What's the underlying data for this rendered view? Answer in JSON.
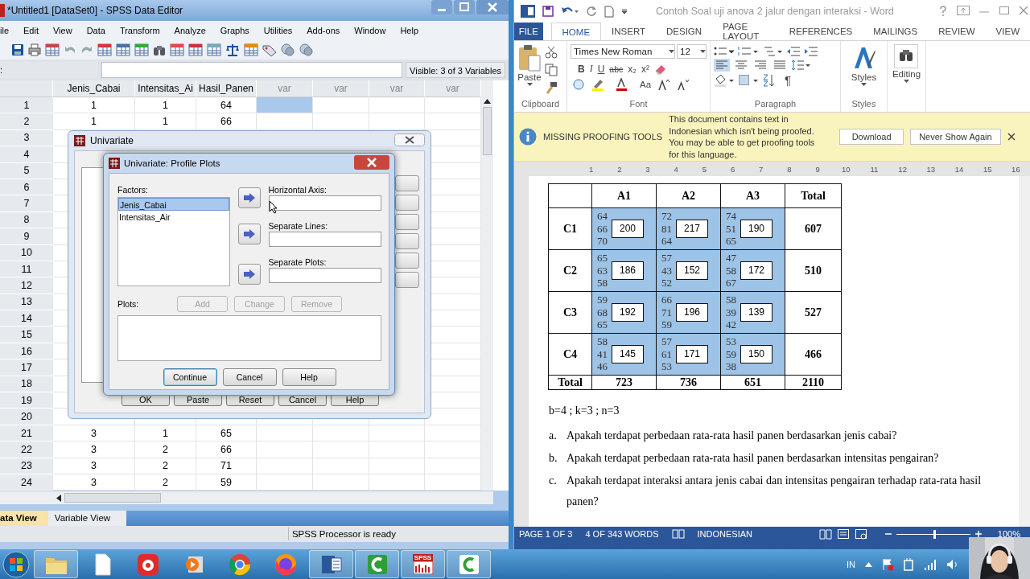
{
  "spss": {
    "title": "*Untitled1 [DataSet0] - SPSS Data Editor",
    "menu": [
      "ile",
      "Edit",
      "View",
      "Data",
      "Transform",
      "Analyze",
      "Graphs",
      "Utilities",
      "Add-ons",
      "Window",
      "Help"
    ],
    "cell_ref": ":",
    "visible_info": "Visible: 3 of 3 Variables",
    "columns": [
      "Jenis_Cabai",
      "Intensitas_Ai",
      "Hasil_Panen",
      "var",
      "var",
      "var",
      "var"
    ],
    "rows": [
      {
        "number": "1",
        "cells": [
          "1",
          "1",
          "64"
        ],
        "var_cell_selected": true
      },
      {
        "number": "2",
        "cells": [
          "1",
          "1",
          "66"
        ],
        "var_cell_selected": false
      },
      {
        "number": "3"
      },
      {
        "number": "4"
      },
      {
        "number": "5"
      },
      {
        "number": "6"
      },
      {
        "number": "7"
      },
      {
        "number": "8"
      },
      {
        "number": "9"
      },
      {
        "number": "10"
      },
      {
        "number": "11"
      },
      {
        "number": "12"
      },
      {
        "number": "13"
      },
      {
        "number": "14"
      },
      {
        "number": "15"
      },
      {
        "number": "16"
      },
      {
        "number": "17"
      },
      {
        "number": "18"
      },
      {
        "number": "19"
      },
      {
        "number": "20"
      },
      {
        "number": "21",
        "cells": [
          "3",
          "1",
          "65"
        ],
        "var_cell_selected": false
      },
      {
        "number": "22",
        "cells": [
          "3",
          "2",
          "66"
        ],
        "var_cell_selected": false
      },
      {
        "number": "23",
        "cells": [
          "3",
          "2",
          "71"
        ],
        "var_cell_selected": false
      },
      {
        "number": "24",
        "cells": [
          "3",
          "2",
          "59"
        ],
        "var_cell_selected": false
      }
    ],
    "tabs": [
      {
        "label": "ata View",
        "selected": true
      },
      {
        "label": "Variable View",
        "selected": false
      }
    ],
    "status": "SPSS  Processor is ready"
  },
  "univariate": {
    "title": "Univariate",
    "buttons": [
      "OK",
      "Paste",
      "Reset",
      "Cancel",
      "Help"
    ]
  },
  "profile_plots": {
    "title": "Univariate: Profile Plots",
    "factors_label": "Factors:",
    "factors": [
      {
        "label": "Jenis_Cabai",
        "selected": true
      },
      {
        "label": "Intensitas_Air",
        "selected": false
      }
    ],
    "targets": [
      "Horizontal Axis:",
      "Separate Lines:",
      "Separate Plots:"
    ],
    "plots_label": "Plots:",
    "plot_buttons": [
      {
        "label": "Add",
        "disabled": true
      },
      {
        "label": "Change",
        "disabled": true
      },
      {
        "label": "Remove",
        "disabled": true
      }
    ],
    "buttons": [
      "Continue",
      "Cancel",
      "Help"
    ]
  },
  "word": {
    "title": "Contoh Soal uji anova 2 jalur dengan interaksi - Word",
    "tabs": [
      {
        "label": "FILE",
        "kind": "file",
        "selected": false
      },
      {
        "label": "HOME",
        "kind": "tab",
        "selected": true
      },
      {
        "label": "INSERT",
        "kind": "tab",
        "selected": false
      },
      {
        "label": "DESIGN",
        "kind": "tab",
        "selected": false
      },
      {
        "label": "PAGE LAYOUT",
        "kind": "tab",
        "selected": false
      },
      {
        "label": "REFERENCES",
        "kind": "tab",
        "selected": false
      },
      {
        "label": "MAILINGS",
        "kind": "tab",
        "selected": false
      },
      {
        "label": "REVIEW",
        "kind": "tab",
        "selected": false
      },
      {
        "label": "VIEW",
        "kind": "tab",
        "selected": false
      }
    ],
    "paste": "Paste",
    "font_name": "Times New Roman",
    "font_size": "12",
    "format_buttons": [
      "B",
      "I",
      "U",
      "abc",
      "x₂",
      "x²"
    ],
    "case_button": "Aa",
    "pilcrow": "¶",
    "alignments": [
      {
        "selected": true
      },
      {
        "selected": false
      },
      {
        "selected": false
      },
      {
        "selected": false
      }
    ],
    "styles": "Styles",
    "editing": "Editing",
    "groups": [
      "Clipboard",
      "Font",
      "Paragraph",
      "Styles"
    ],
    "message": {
      "title": "MISSING PROOFING TOOLS",
      "text": "This document contains text in Indonesian which isn't being proofed. You may be able to get proofing tools for this language.",
      "buttons": [
        "Download",
        "Never Show Again"
      ]
    },
    "ruler": [
      "1",
      "2",
      "3",
      "4",
      "5",
      "6",
      "7",
      "8",
      "9",
      "10",
      "11",
      "12",
      "13",
      "14",
      "15",
      "16"
    ],
    "table": {
      "columns": [
        "A1",
        "A2",
        "A3",
        "Total"
      ],
      "rows": [
        {
          "label": "C1",
          "cells": [
            {
              "values": [
                "64",
                "66",
                "70"
              ],
              "sum": "200",
              "selected": true
            },
            {
              "values": [
                "72",
                "81",
                "64"
              ],
              "sum": "217",
              "selected": true
            },
            {
              "values": [
                "74",
                "51",
                "65"
              ],
              "sum": "190",
              "selected": true
            }
          ],
          "total": "607"
        },
        {
          "label": "C2",
          "cells": [
            {
              "values": [
                "65",
                "63",
                "58"
              ],
              "sum": "186",
              "selected": true
            },
            {
              "values": [
                "57",
                "43",
                "52"
              ],
              "sum": "152",
              "selected": true
            },
            {
              "values": [
                "47",
                "58",
                "67"
              ],
              "sum": "172",
              "selected": true
            }
          ],
          "total": "510"
        },
        {
          "label": "C3",
          "cells": [
            {
              "values": [
                "59",
                "68",
                "65"
              ],
              "sum": "192",
              "selected": true
            },
            {
              "values": [
                "66",
                "71",
                "59"
              ],
              "sum": "196",
              "selected": true
            },
            {
              "values": [
                "58",
                "39",
                "42"
              ],
              "sum": "139",
              "selected": true
            }
          ],
          "total": "527"
        },
        {
          "label": "C4",
          "cells": [
            {
              "values": [
                "58",
                "41",
                "46"
              ],
              "sum": "145",
              "selected": true
            },
            {
              "values": [
                "57",
                "61",
                "53"
              ],
              "sum": "171",
              "selected": true
            },
            {
              "values": [
                "53",
                "59",
                "38"
              ],
              "sum": "150",
              "selected": true
            }
          ],
          "total": "466"
        }
      ],
      "footer": {
        "label": "Total",
        "values": [
          "723",
          "736",
          "651",
          "2110"
        ]
      }
    },
    "params": "b=4 ; k=3 ; n=3",
    "questions": [
      {
        "marker": "a.",
        "text": "Apakah terdapat perbedaan rata-rata hasil panen berdasarkan jenis cabai?"
      },
      {
        "marker": "b.",
        "text": "Apakah terdapat perbedaan rata-rata hasil panen berdasarkan intensitas pengairan?"
      },
      {
        "marker": "c.",
        "text": "Apakah terdapat interaksi antara jenis cabai dan intensitas pengairan terhadap rata-rata hasil panen?"
      }
    ],
    "status": {
      "page": "PAGE 1 OF 3",
      "words": "4 OF 343 WORDS",
      "language": "INDONESIAN",
      "zoom": {
        "level": 0.5,
        "reading": "100%"
      }
    }
  },
  "taskbar": {
    "spss_label": "SPSS",
    "input_language": "IN"
  }
}
